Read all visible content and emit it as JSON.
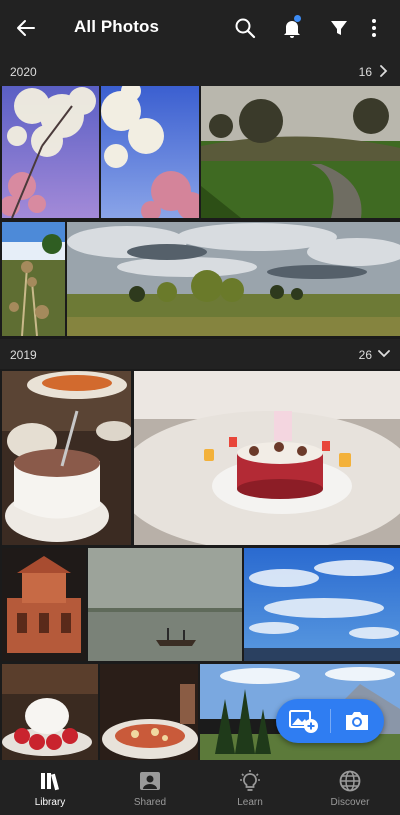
{
  "header": {
    "title": "All Photos",
    "icons": [
      "back-arrow-icon",
      "search-icon",
      "bell-icon",
      "filter-icon",
      "more-vertical-icon"
    ]
  },
  "sections": [
    {
      "year": "2020",
      "count": "16",
      "state": "collapsed"
    },
    {
      "year": "2019",
      "count": "26",
      "state": "expanded"
    }
  ],
  "fab": {
    "icons": [
      "add-photo-icon",
      "camera-icon"
    ]
  },
  "bottom_nav": {
    "items": [
      {
        "label": "Library",
        "icon": "library-icon",
        "active": true
      },
      {
        "label": "Shared",
        "icon": "shared-people-icon",
        "active": false
      },
      {
        "label": "Learn",
        "icon": "lightbulb-icon",
        "active": false
      },
      {
        "label": "Discover",
        "icon": "globe-icon",
        "active": false
      }
    ]
  },
  "colors": {
    "accent": "#2f7df2",
    "notification_dot": "#3d8cf5",
    "bar_bg": "#222222"
  }
}
